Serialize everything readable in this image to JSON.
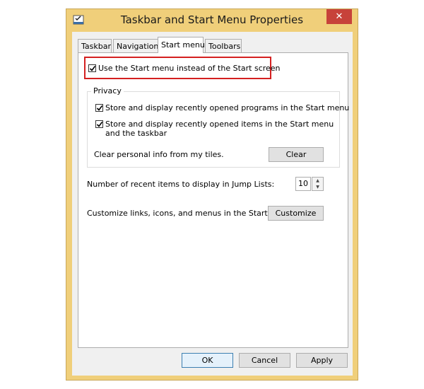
{
  "window": {
    "title": "Taskbar and Start Menu Properties",
    "close_glyph": "✕",
    "app_icon": "taskbar-properties-icon"
  },
  "tabs": [
    {
      "label": "Taskbar",
      "active": false
    },
    {
      "label": "Navigation",
      "active": false
    },
    {
      "label": "Start menu",
      "active": true
    },
    {
      "label": "Toolbars",
      "active": false
    }
  ],
  "start_menu": {
    "use_start_menu": {
      "label": "Use the Start menu instead of the Start screen",
      "checked": true
    },
    "privacy": {
      "title": "Privacy",
      "recent_programs": {
        "label": "Store and display recently opened programs in the Start menu",
        "checked": true
      },
      "recent_items": {
        "label": "Store and display recently opened items in the Start menu and the taskbar",
        "checked": true
      },
      "clear_label": "Clear personal info from my tiles.",
      "clear_button": "Clear"
    },
    "jump_lists": {
      "label": "Number of recent items to display in Jump Lists:",
      "value": "10"
    },
    "customize": {
      "label": "Customize links, icons, and menus in the Start menu.",
      "button": "Customize"
    }
  },
  "footer": {
    "ok": "OK",
    "cancel": "Cancel",
    "apply": "Apply"
  },
  "colors": {
    "frame": "#f0cf7a",
    "close": "#c7423a",
    "highlight": "#d42020"
  }
}
